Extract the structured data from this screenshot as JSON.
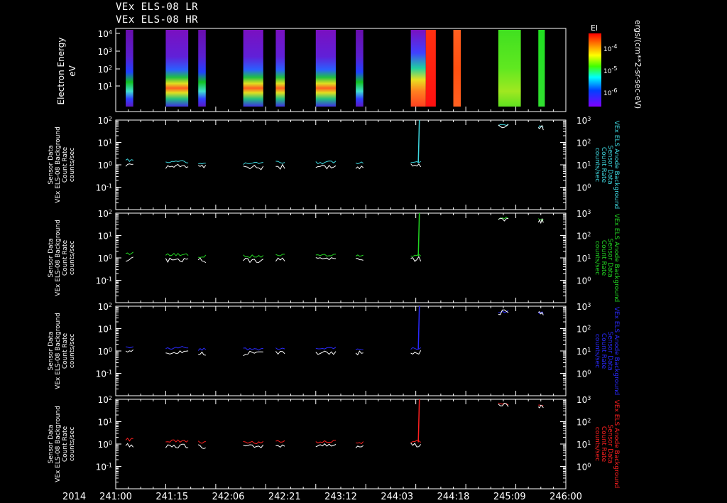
{
  "titles": [
    "VEx ELS-08 LR",
    "VEx ELS-08 HR"
  ],
  "spectrogram": {
    "ylabel": "Electron Energy\neV",
    "yticks": [
      "10^4",
      "10^3",
      "10^2",
      "10^1"
    ],
    "colorbar_title": "El",
    "colorbar_label": "ergs/(cm**2-sr-sec-eV)",
    "colorbar_ticks": [
      "10^-4",
      "10^-5",
      "10^-6"
    ],
    "segments": [
      {
        "start": 0.2,
        "end": 0.35,
        "style": "quiet"
      },
      {
        "start": 1.0,
        "end": 1.45,
        "style": "active"
      },
      {
        "start": 1.65,
        "end": 1.8,
        "style": "quiet"
      },
      {
        "start": 2.55,
        "end": 2.95,
        "style": "active"
      },
      {
        "start": 3.2,
        "end": 3.38,
        "style": "active"
      },
      {
        "start": 4.0,
        "end": 4.4,
        "style": "active"
      },
      {
        "start": 4.8,
        "end": 4.95,
        "style": "quiet"
      },
      {
        "start": 5.9,
        "end": 6.2,
        "style": "bright"
      },
      {
        "start": 6.2,
        "end": 6.4,
        "style": "red"
      },
      {
        "start": 6.75,
        "end": 6.9,
        "style": "orange"
      },
      {
        "start": 7.65,
        "end": 8.1,
        "style": "green"
      },
      {
        "start": 8.45,
        "end": 8.58,
        "style": "green2"
      }
    ]
  },
  "panels": [
    {
      "left_label": "Sensor Data\nVEx ELS-08 Background\nCount Rate\ncounts/sec",
      "right_label": "VEx ELS Anode Background\nSensor Data\nCount Rate\ncounts/sec",
      "color": "#3fd8e0"
    },
    {
      "left_label": "Sensor Data\nVEx ELS-08 Background\nCount Rate\ncounts/sec",
      "right_label": "VEx ELS Anode Background\nSensor Data\nCount Rate\ncounts/sec",
      "color": "#22d622"
    },
    {
      "left_label": "Sensor Data\nVEx ELS-08 Background\nCount Rate\ncounts/sec",
      "right_label": "VEx ELS Anode Background\nSensor Data\nCount Rate\ncounts/sec",
      "color": "#2a2aff"
    },
    {
      "left_label": "Sensor Data\nVEx ELS-08 Background\nCount Rate\ncounts/sec",
      "right_label": "VEx ELS Anode Background\nSensor Data\nCount Rate\ncounts/sec",
      "color": "#ff2020"
    }
  ],
  "chart_data": {
    "type": "line",
    "x_ticks": [
      "241:00",
      "241:15",
      "242:06",
      "242:21",
      "243:12",
      "244:03",
      "244:18",
      "245:09",
      "246:00"
    ],
    "year_label": "2014",
    "left_yticks": [
      "10^2",
      "10^1",
      "10^0",
      "10^-1"
    ],
    "right_yticks": [
      "10^3",
      "10^2",
      "10^1",
      "10^0"
    ],
    "ylim": [
      0.01,
      100
    ],
    "segments": [
      {
        "x": [
          0.2,
          0.35
        ],
        "value": 1.6,
        "white": 1.0
      },
      {
        "x": [
          1.0,
          1.45
        ],
        "value": 1.4,
        "white": 0.9
      },
      {
        "x": [
          1.65,
          1.8
        ],
        "value": 1.2,
        "white": 0.85
      },
      {
        "x": [
          2.55,
          2.95
        ],
        "value": 1.2,
        "white": 0.85
      },
      {
        "x": [
          3.2,
          3.38
        ],
        "value": 1.3,
        "white": 0.9
      },
      {
        "x": [
          4.0,
          4.4
        ],
        "value": 1.3,
        "white": 0.9
      },
      {
        "x": [
          4.8,
          4.95
        ],
        "value": 1.2,
        "white": 0.9
      },
      {
        "x": [
          5.9,
          6.1
        ],
        "value": 1.3,
        "white": 1.0
      },
      {
        "x": [
          7.65,
          7.85
        ],
        "value": 60,
        "white": 60
      },
      {
        "x": [
          8.45,
          8.55
        ],
        "value": 50,
        "white": 50
      }
    ],
    "x_max": 9
  }
}
